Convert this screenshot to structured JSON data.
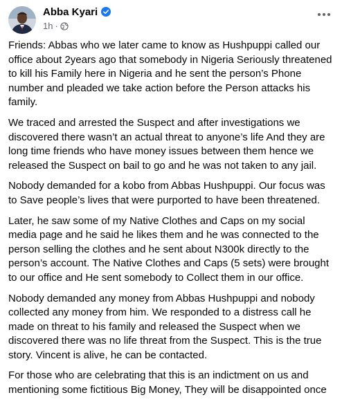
{
  "post": {
    "author": "Abba Kyari",
    "timestamp": "1h",
    "separator": "·",
    "icons": {
      "verified": "verified-badge-icon",
      "audience": "globe-icon",
      "more": "more-options-icon"
    },
    "colors": {
      "verified": "#1877f2",
      "meta_text": "#65676b",
      "body_text": "#050505"
    },
    "paragraphs": [
      "Friends: Abbas who we later came to know as Hushpuppi called our office about 2years ago that somebody in Nigeria Seriously threatened to kill his Family here in Nigeria and he sent the person’s Phone number and pleaded we take action before the Person attacks his family.",
      "We traced and arrested the Suspect and after investigations we discovered there wasn’t an actual threat to anyone’s life And they are long time friends who have money issues between them hence we released the Suspect on bail to go and he was not taken to any jail.",
      "Nobody demanded for a kobo from Abbas Hushpuppi. Our focus was to Save people’s lives that were purported to have been threatened.",
      "Later, he saw some of my Native Clothes and Caps on my social media page and he said he likes them and he was connected to the person selling the clothes and he sent about N300k directly to the person’s account. The Native Clothes and Caps (5 sets) were brought to our office and He sent somebody to Collect them in our office.",
      "Nobody demanded any money from Abbas Hushpuppi and nobody collected any money from him. We responded to a distress call he made on threat to his family and released the Suspect when we discovered there was no life threat from the Suspect. This is the true story. Vincent is alive, he can be contacted.",
      "For those who are celebrating that  this is an indictment on us and mentioning some fictitious Big Money, They will be disappointed once"
    ]
  }
}
